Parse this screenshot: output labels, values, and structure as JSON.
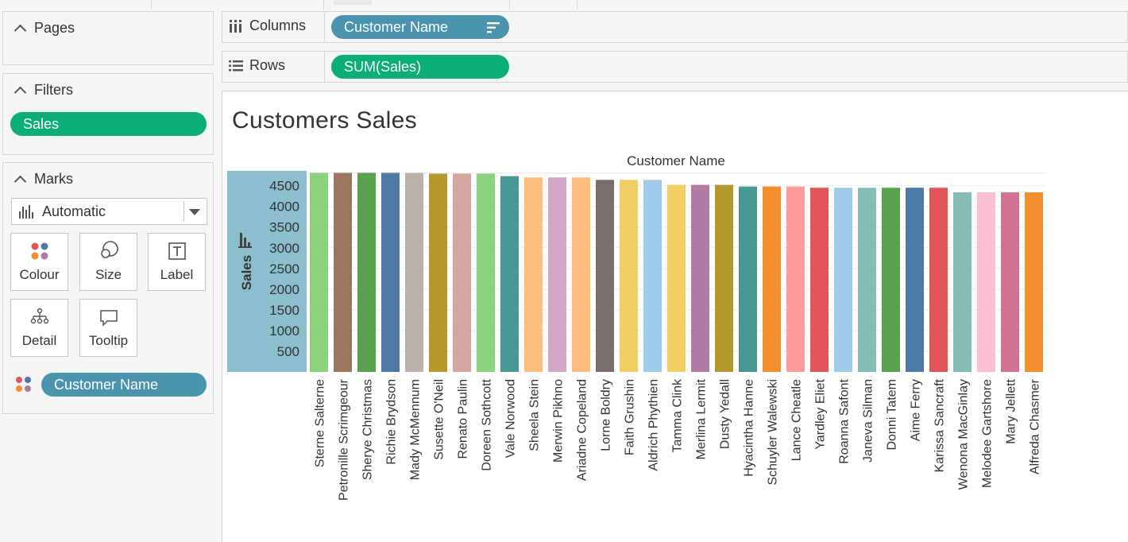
{
  "panels": {
    "pages": {
      "title": "Pages"
    },
    "filters": {
      "title": "Filters",
      "pill": "Sales"
    },
    "marks": {
      "title": "Marks",
      "type": "Automatic",
      "buttons": {
        "colour": "Colour",
        "size": "Size",
        "label": "Label",
        "detail": "Detail",
        "tooltip": "Tooltip"
      },
      "color_pill": "Customer Name"
    }
  },
  "shelves": {
    "columns": {
      "label": "Columns",
      "pill": "Customer Name"
    },
    "rows": {
      "label": "Rows",
      "pill": "SUM(Sales)"
    }
  },
  "view": {
    "title": "Customers Sales"
  },
  "colors": {
    "green_pill": "#0bad79",
    "blue_pill": "#4a94b0",
    "axis_band": "#8bbfcf"
  },
  "chart_data": {
    "type": "bar",
    "title": "Customers Sales",
    "xlabel": "Customer Name",
    "ylabel": "Sales",
    "ylim": [
      0,
      4800
    ],
    "yticks": [
      500,
      1000,
      1500,
      2000,
      2500,
      3000,
      3500,
      4000,
      4500
    ],
    "grid": true,
    "categories": [
      "Sterne Salterne",
      "Petronille Scrimgeour",
      "Sherye Christmas",
      "Richie Brydson",
      "Mady McMennum",
      "Susette O'Neil",
      "Renato Paulin",
      "Doreen Sothcott",
      "Vale Norwood",
      "Sheela Stein",
      "Merwin Pikhno",
      "Ariadne Copeland",
      "Lorne Boldry",
      "Faith Grushin",
      "Aldrich Phythien",
      "Tamma Clink",
      "Merlina Lermit",
      "Dusty Yedall",
      "Hyacintha Hanne",
      "Schuyler Walewski",
      "Lance Cheatle",
      "Yardley Eliet",
      "Roanna Safont",
      "Janeva Silman",
      "Donni Tatem",
      "Aime Ferry",
      "Karissa Sancraft",
      "Wenona MacGinlay",
      "Melodee Gartshore",
      "Mary Jellett",
      "Alfreda Chasmer"
    ],
    "values": [
      4810,
      4810,
      4810,
      4810,
      4810,
      4790,
      4790,
      4790,
      4730,
      4700,
      4700,
      4700,
      4640,
      4640,
      4640,
      4520,
      4520,
      4520,
      4480,
      4480,
      4480,
      4450,
      4450,
      4450,
      4450,
      4450,
      4450,
      4340,
      4340,
      4340,
      4340
    ],
    "colors": [
      "#8cd17d",
      "#9d7660",
      "#59a14f",
      "#4e79a7",
      "#bab0ac",
      "#b6992d",
      "#d4a6a0",
      "#8cd17d",
      "#499894",
      "#ffbe7d",
      "#d4a6c8",
      "#ffbe7d",
      "#79706e",
      "#f1ce63",
      "#a0cbe8",
      "#f1ce63",
      "#b07aa1",
      "#b6992d",
      "#499894",
      "#f28e2b",
      "#ff9d9a",
      "#e15759",
      "#a0cbe8",
      "#86bcb6",
      "#59a14f",
      "#4e79a7",
      "#e15759",
      "#86bcb6",
      "#fabfd2",
      "#d37295",
      "#f28e2b"
    ]
  }
}
